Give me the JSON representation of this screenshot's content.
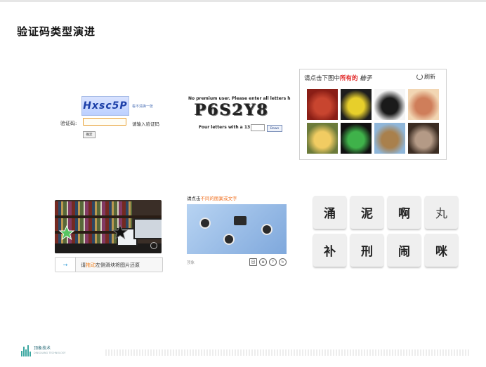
{
  "title": "验证码类型演进",
  "text_captcha": {
    "code": "Hxsc5P",
    "refresh_link": "看不清换一张",
    "label": "验证码:",
    "hint": "请输入验证码",
    "submit": "确定"
  },
  "distorted_captcha": {
    "top_text": "No premium user. Please enter all letters h",
    "code": "P6S2Y8",
    "prompt": "Four letters with a",
    "sample": "13",
    "button": "Down"
  },
  "image_select": {
    "prompt_prefix": "请点击下图中",
    "prompt_highlight": "所有的",
    "prompt_object": "桔子",
    "refresh": "刷新",
    "cells": [
      {
        "name": "dates",
        "c1": "#8a1e16",
        "c2": "#c8452f"
      },
      {
        "name": "flashlight",
        "c1": "#1e1e1e",
        "c2": "#e7cf2b"
      },
      {
        "name": "torch",
        "c1": "#f5f5f5",
        "c2": "#1a1a1a"
      },
      {
        "name": "cake",
        "c1": "#f2d6b3",
        "c2": "#cf7e5a"
      },
      {
        "name": "zongzi",
        "c1": "#6c7b3a",
        "c2": "#f1cc62"
      },
      {
        "name": "traffic-light",
        "c1": "#111",
        "c2": "#3fb24a"
      },
      {
        "name": "camel",
        "c1": "#8fb6d9",
        "c2": "#a9804c"
      },
      {
        "name": "lion-art",
        "c1": "#3b2c22",
        "c2": "#b49a86"
      }
    ]
  },
  "slider_captcha": {
    "hint_prefix": "请",
    "hint_highlight": "拖动",
    "hint_suffix": "左侧滑块将图片还原",
    "knob": "→"
  },
  "icon_captcha": {
    "label_prefix": "请点击",
    "label_highlight": "不同的图案或文字",
    "logo": "顶象",
    "tools": [
      "回",
      "⊕",
      "?",
      "↻"
    ]
  },
  "char_grid": {
    "chars": [
      "涌",
      "泥",
      "啊",
      "丸",
      "补",
      "刑",
      "闹",
      "咪"
    ]
  },
  "footer": {
    "brand": "顶象技术",
    "brand_en": "DINGXIANG TECHNOLOGY"
  }
}
